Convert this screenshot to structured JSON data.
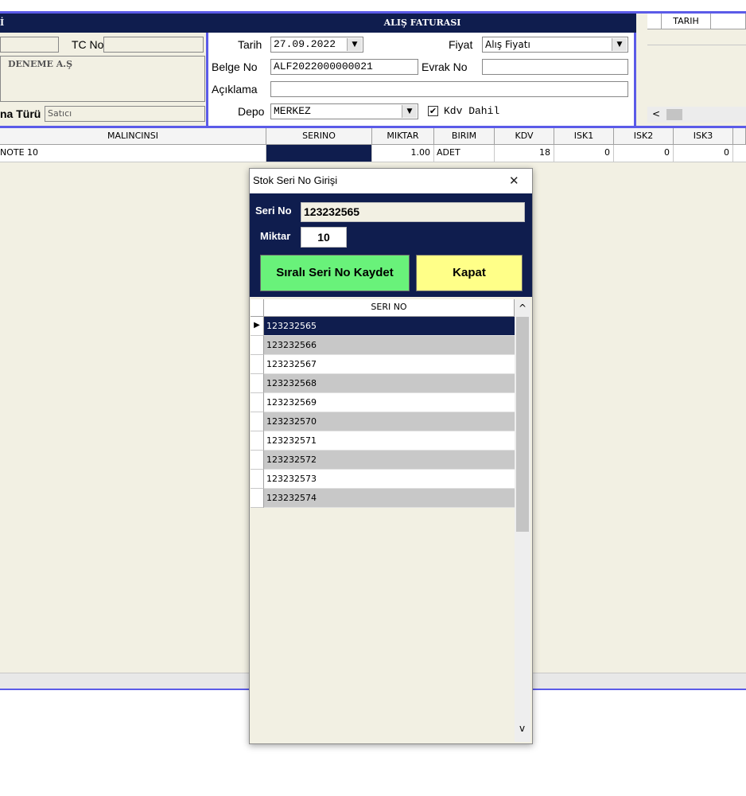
{
  "left_panel": {
    "title": "İ",
    "tc_label": "TC No",
    "tc_value": "",
    "company": "DENEME A.Ş",
    "type_label": "na Türü",
    "type_value": "Satıcı"
  },
  "invoice": {
    "title": "ALIŞ FATURASI",
    "date_label": "Tarih",
    "date_value": "27.09.2022",
    "price_label": "Fiyat",
    "price_value": "Alış Fiyatı",
    "doc_label": "Belge No",
    "doc_value": "ALF2022000000021",
    "evrak_label": "Evrak No",
    "evrak_value": "",
    "desc_label": "Açıklama",
    "desc_value": "",
    "depot_label": "Depo",
    "depot_value": "MERKEZ",
    "kdv_label": "Kdv Dahil",
    "kdv_checked": true
  },
  "right_panel": {
    "col": "TARIH",
    "scroll_left": "<"
  },
  "items_table": {
    "headers": [
      "MALINCINSI",
      "SERINO",
      "MIKTAR",
      "BIRIM",
      "KDV",
      "ISK1",
      "ISK2",
      "ISK3"
    ],
    "rows": [
      [
        "NOTE 10",
        "",
        "1.00",
        "ADET",
        "18",
        "0",
        "0",
        "0"
      ]
    ]
  },
  "dialog": {
    "title": "Stok Seri No Girişi",
    "close": "✕",
    "serial_label": "Seri No",
    "serial_value": "123232565",
    "qty_label": "Miktar",
    "qty_value": "10",
    "save_button": "Sıralı Seri No Kaydet",
    "close_button": "Kapat",
    "list_header": "SERI NO",
    "serials": [
      "123232565",
      "123232566",
      "123232567",
      "123232568",
      "123232569",
      "123232570",
      "123232571",
      "123232572",
      "123232573",
      "123232574"
    ],
    "scroll_up": "^",
    "scroll_down": "v"
  },
  "colors": {
    "navy": "#0f1d4e",
    "panel": "#f2f0e3",
    "green_button": "#69f27a",
    "yellow_button": "#ffff88",
    "accent_border": "#5b5be8"
  }
}
